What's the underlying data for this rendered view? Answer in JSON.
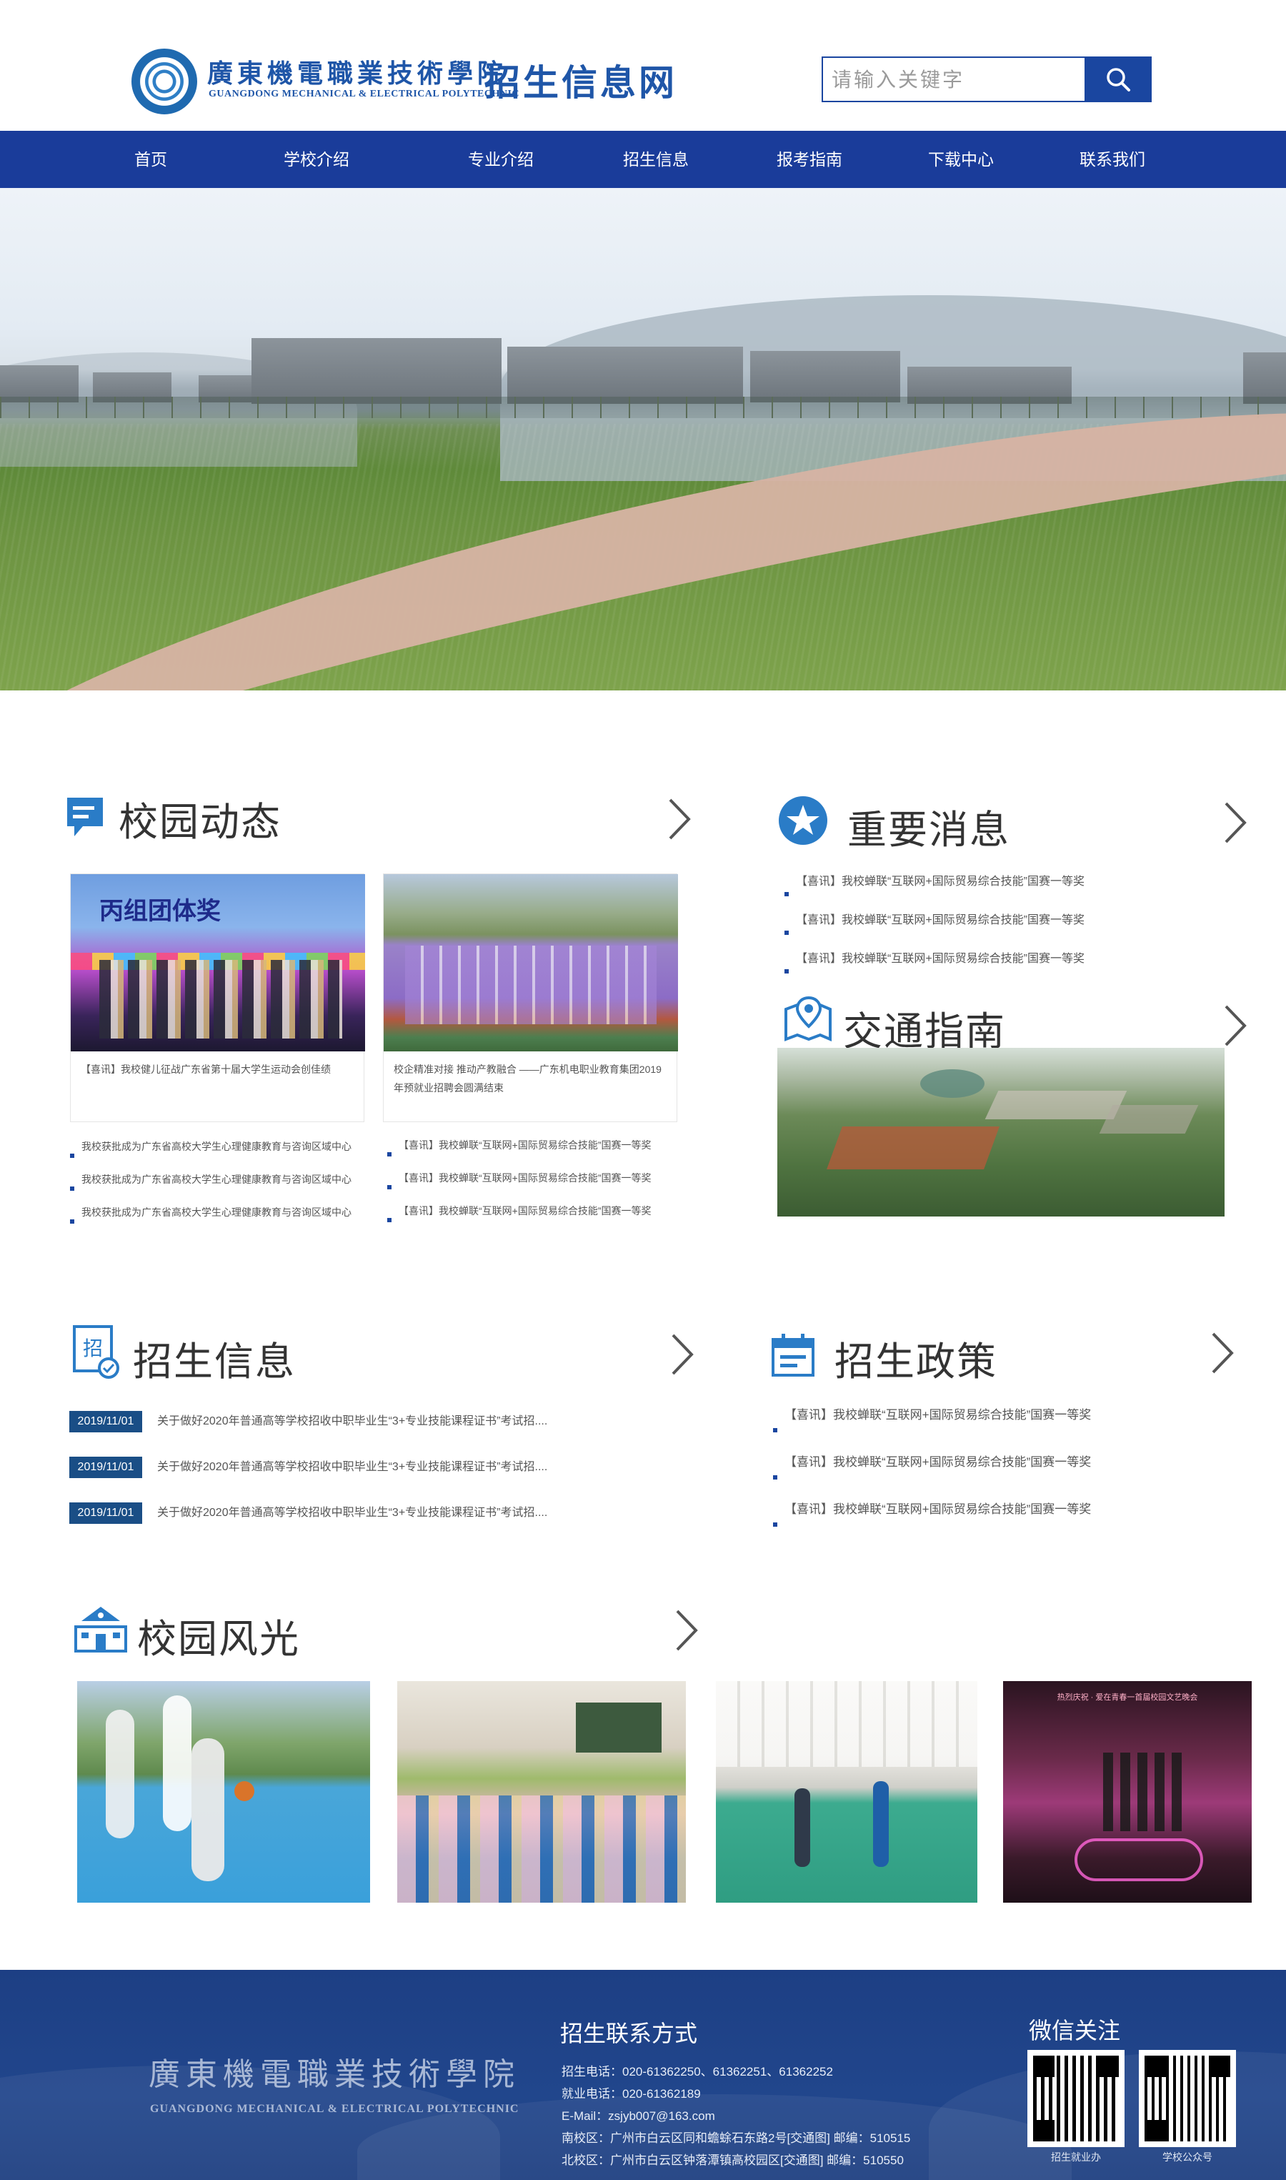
{
  "header": {
    "logo_cn": "廣東機電職業技術學院",
    "logo_en": "GUANGDONG MECHANICAL & ELECTRICAL POLYTECHNIC",
    "site_title": "招生信息网",
    "search_placeholder": "请输入关键字"
  },
  "nav": [
    "首页",
    "学校介绍",
    "专业介绍",
    "招生信息",
    "报考指南",
    "下载中心",
    "联系我们"
  ],
  "campus_news": {
    "title": "校园动态",
    "cards": [
      {
        "image_text": "丙组团体奖",
        "caption": "【喜讯】我校健儿征战广东省第十届大学生运动会创佳绩"
      },
      {
        "caption": "校企精准对接 推动产教融合 ——广东机电职业教育集团2019年预就业招聘会圆满结束"
      }
    ],
    "left_list": [
      "我校获批成为广东省高校大学生心理健康教育与咨询区域中心",
      "我校获批成为广东省高校大学生心理健康教育与咨询区域中心",
      "我校获批成为广东省高校大学生心理健康教育与咨询区域中心"
    ],
    "right_list": [
      "【喜讯】我校蝉联“互联网+国际贸易综合技能”国赛一等奖",
      "【喜讯】我校蝉联“互联网+国际贸易综合技能”国赛一等奖",
      "【喜讯】我校蝉联“互联网+国际贸易综合技能”国赛一等奖"
    ]
  },
  "important_news": {
    "title": "重要消息",
    "items": [
      "【喜讯】我校蝉联“互联网+国际贸易综合技能”国赛一等奖",
      "【喜讯】我校蝉联“互联网+国际贸易综合技能”国赛一等奖",
      "【喜讯】我校蝉联“互联网+国际贸易综合技能”国赛一等奖"
    ]
  },
  "traffic": {
    "title": "交通指南"
  },
  "admission_info": {
    "title": "招生信息",
    "items": [
      {
        "date": "2019/11/01",
        "text": "关于做好2020年普通高等学校招收中职毕业生“3+专业技能课程证书”考试招...."
      },
      {
        "date": "2019/11/01",
        "text": "关于做好2020年普通高等学校招收中职毕业生“3+专业技能课程证书”考试招...."
      },
      {
        "date": "2019/11/01",
        "text": "关于做好2020年普通高等学校招收中职毕业生“3+专业技能课程证书”考试招...."
      }
    ]
  },
  "admission_policy": {
    "title": "招生政策",
    "items": [
      "【喜讯】我校蝉联“互联网+国际贸易综合技能”国赛一等奖",
      "【喜讯】我校蝉联“互联网+国际贸易综合技能”国赛一等奖",
      "【喜讯】我校蝉联“互联网+国际贸易综合技能”国赛一等奖"
    ]
  },
  "scenery": {
    "title": "校园风光",
    "photo4_banner": "热烈庆祝 · 爱在青春一首届校园文艺晚会"
  },
  "footer": {
    "logo_cn": "廣東機電職業技術學院",
    "logo_en": "GUANGDONG MECHANICAL & ELECTRICAL POLYTECHNIC",
    "contact_title": "招生联系方式",
    "lines": [
      "招生电话：020-61362250、61362251、61362252",
      "就业电话：020-61362189",
      "E-Mail：zsjyb007@163.com",
      "南校区：广州市白云区同和蟾蜍石东路2号[交通图] 邮编：510515",
      "北校区：广州市白云区钟落潭镇高校园区[交通图] 邮编：510550"
    ],
    "wechat_title": "微信关注",
    "qr_captions": [
      "招生就业办",
      "学校公众号"
    ]
  },
  "colors": {
    "brand": "#1a3c9a",
    "accent": "#1a4e86",
    "icon": "#2a7cc7"
  }
}
